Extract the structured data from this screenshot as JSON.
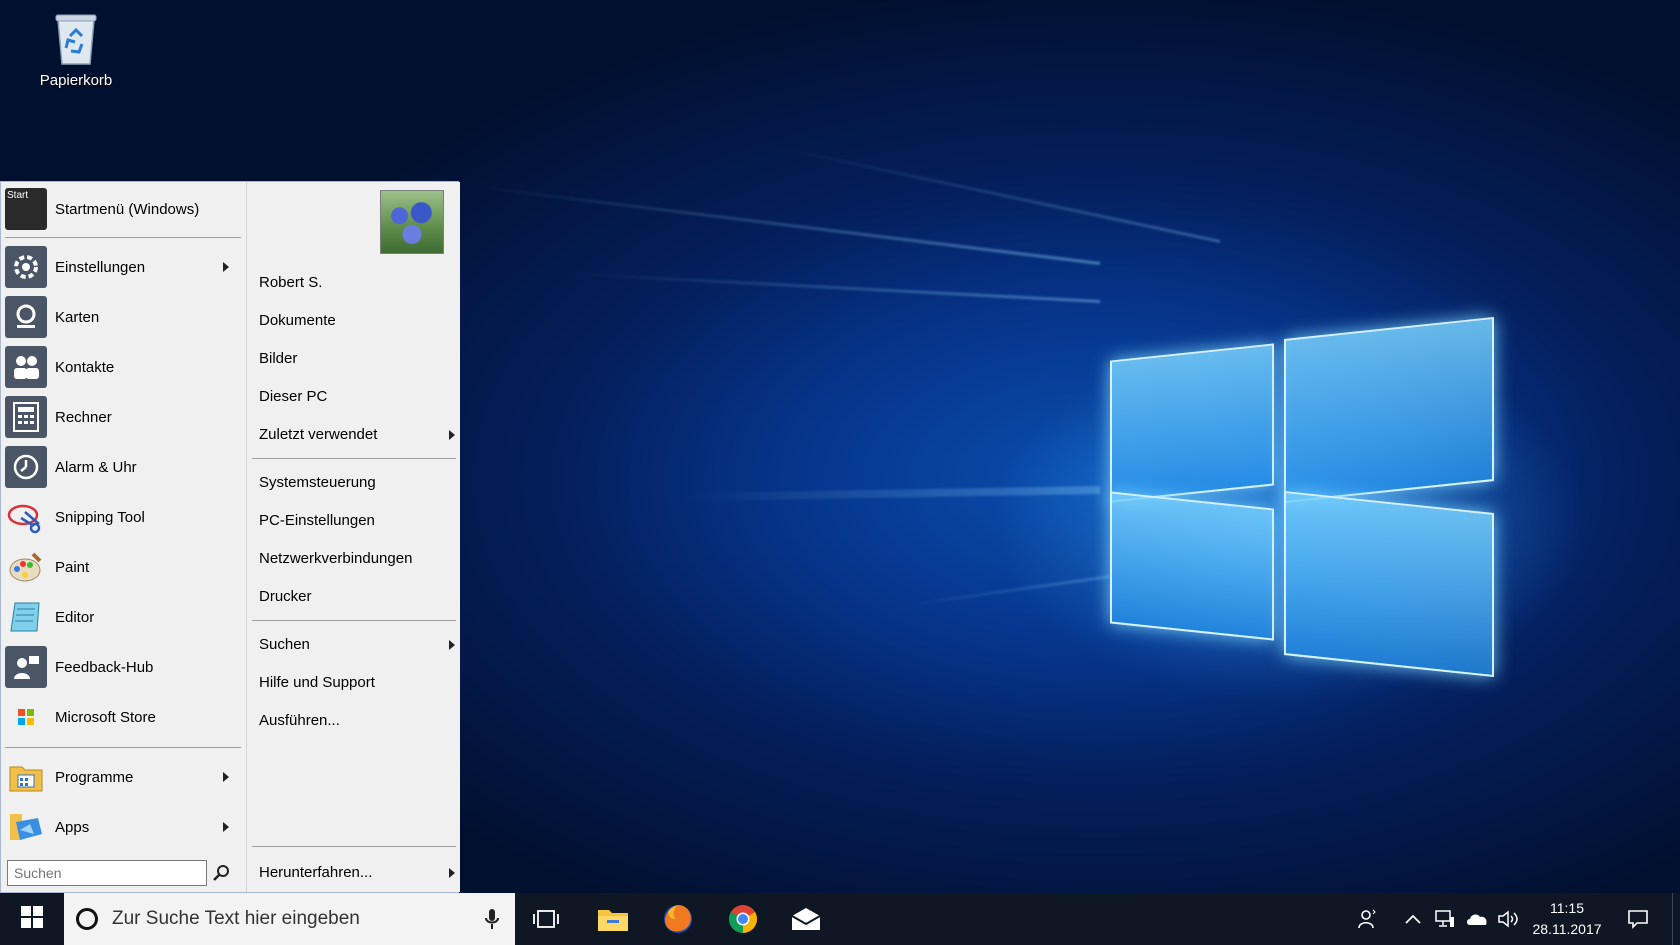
{
  "desktop": {
    "recycle_bin_label": "Papierkorb"
  },
  "start_menu": {
    "header": {
      "label": "Startmenü (Windows)",
      "icon": "start-tile-icon",
      "icon_text": "Start"
    },
    "left_items": [
      {
        "label": "Einstellungen",
        "icon": "gear-icon",
        "submenu": true
      },
      {
        "label": "Karten",
        "icon": "maps-icon",
        "submenu": false
      },
      {
        "label": "Kontakte",
        "icon": "contacts-icon",
        "submenu": false
      },
      {
        "label": "Rechner",
        "icon": "calculator-icon",
        "submenu": false
      },
      {
        "label": "Alarm & Uhr",
        "icon": "alarm-clock-icon",
        "submenu": false
      },
      {
        "label": "Snipping Tool",
        "icon": "snipping-tool-icon",
        "submenu": false
      },
      {
        "label": "Paint",
        "icon": "paint-palette-icon",
        "submenu": false
      },
      {
        "label": "Editor",
        "icon": "notepad-icon",
        "submenu": false
      },
      {
        "label": "Feedback-Hub",
        "icon": "feedback-hub-icon",
        "submenu": false
      },
      {
        "label": "Microsoft Store",
        "icon": "store-icon",
        "submenu": false
      }
    ],
    "bottom_items": [
      {
        "label": "Programme",
        "icon": "programs-folder-icon",
        "submenu": true
      },
      {
        "label": "Apps",
        "icon": "apps-icon",
        "submenu": true
      }
    ],
    "search_placeholder": "Suchen",
    "right_items_group1": [
      {
        "label": "Robert S.",
        "submenu": false
      },
      {
        "label": "Dokumente",
        "submenu": false
      },
      {
        "label": "Bilder",
        "submenu": false
      },
      {
        "label": "Dieser PC",
        "submenu": false
      },
      {
        "label": "Zuletzt verwendet",
        "submenu": true
      }
    ],
    "right_items_group2": [
      {
        "label": "Systemsteuerung",
        "submenu": false
      },
      {
        "label": "PC-Einstellungen",
        "submenu": false
      },
      {
        "label": "Netzwerkverbindungen",
        "submenu": false
      },
      {
        "label": "Drucker",
        "submenu": false
      }
    ],
    "right_items_group3": [
      {
        "label": "Suchen",
        "submenu": true
      },
      {
        "label": "Hilfe und Support",
        "submenu": false
      },
      {
        "label": "Ausführen...",
        "submenu": false
      }
    ],
    "shutdown": {
      "label": "Herunterfahren...",
      "submenu": true
    }
  },
  "taskbar": {
    "search_placeholder": "Zur Suche Text hier eingeben",
    "time": "11:15",
    "date": "28.11.2017",
    "apps": [
      "task-view-icon",
      "file-explorer-icon",
      "firefox-icon",
      "chrome-icon",
      "mail-icon"
    ],
    "tray": [
      "people-icon",
      "chevron-up-icon",
      "network-icon",
      "onedrive-icon",
      "volume-icon"
    ]
  },
  "colors": {
    "taskbar_bg": "#0f1724",
    "menu_bg": "#f0f0f0",
    "desktop_accent": "#0a4fb0"
  }
}
